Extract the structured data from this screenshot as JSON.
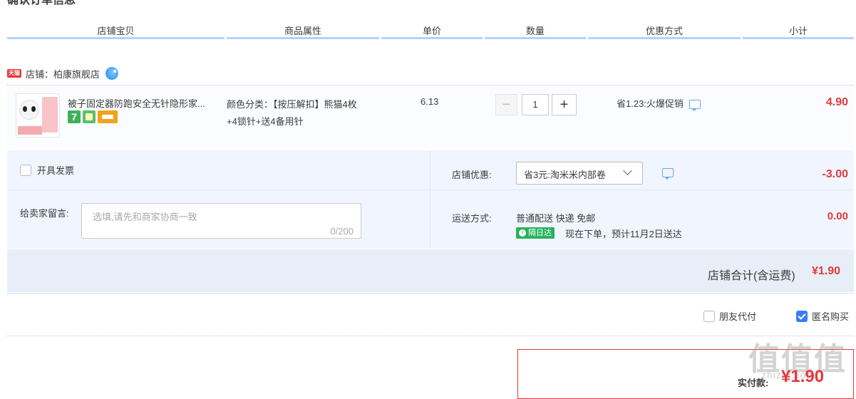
{
  "section_title": "确认订单信息",
  "headers": [
    "店铺宝贝",
    "商品属性",
    "单价",
    "数量",
    "优惠方式",
    "小计"
  ],
  "shop": {
    "badge": "天猫",
    "label": "店铺：柏康旗舰店"
  },
  "item": {
    "title": "被子固定器防跑安全无针隐形家...",
    "attr_line1": "颜色分类：【按压解扣】熊猫4枚",
    "attr_line2": "+4锁针+送4备用针",
    "price": "6.13",
    "qty": "1",
    "qty_minus": "−",
    "qty_plus": "+",
    "promo": "省1.23:火爆促销",
    "subtotal": "4.90",
    "service_icon_7": "7"
  },
  "options": {
    "invoice_label": "开具发票",
    "shop_discount_label": "店铺优惠:",
    "shop_discount_value": "省3元:淘米米内部卷",
    "shop_discount_amount": "-3.00",
    "message_label": "给卖家留言:",
    "message_placeholder": "选填,请先和商家协商一致",
    "message_count": "0/200",
    "shipping_label": "运送方式:",
    "shipping_value": "普通配送 快递 免邮",
    "shipping_amount": "0.00",
    "nextday_badge": "隔日达",
    "delivery_note": "现在下单，预计11月2日送达"
  },
  "total": {
    "label": "店铺合计(含运费)",
    "amount": "¥1.90"
  },
  "checkout": {
    "friend_pay_label": "朋友代付",
    "anonymous_label": "匿名购买",
    "anonymous_checked": true,
    "pay_label": "实付款:",
    "pay_amount": "¥1.90"
  },
  "watermark": {
    "main": "值值值",
    "sub": "zhizhi.com"
  },
  "colors": {
    "accent_red": "#e4393c",
    "header_line": "#b2d1ff",
    "option_bg": "#f0f5ff",
    "nextday_green": "#27b35c"
  }
}
